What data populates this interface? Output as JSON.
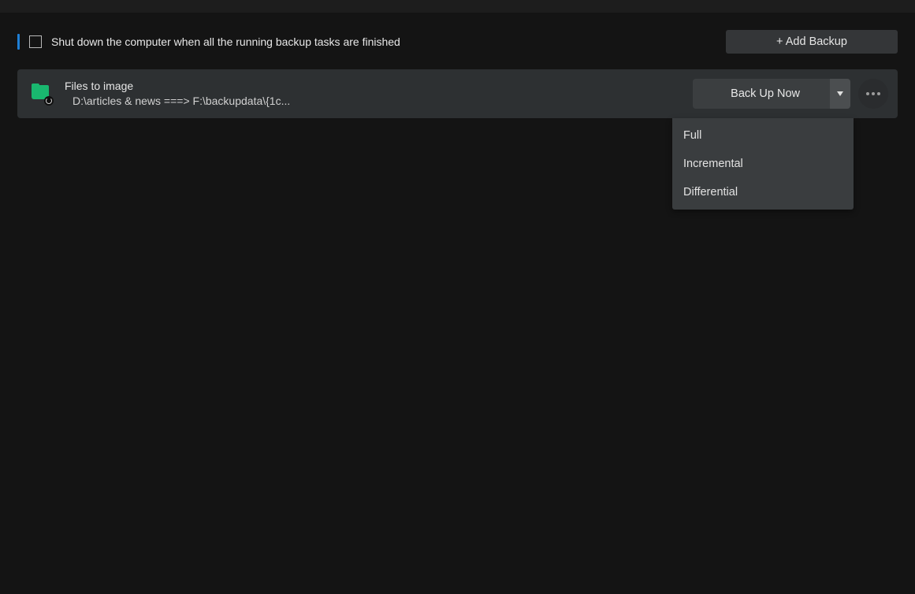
{
  "toolbar": {
    "shutdown_label": "Shut down the computer when all the running backup tasks are finished",
    "add_backup_label": "+ Add Backup"
  },
  "task": {
    "title": "Files to image",
    "subtitle": "D:\\articles & news ===> F:\\backupdata\\{1c...",
    "backup_now_label": "Back Up Now"
  },
  "menu": {
    "full": "Full",
    "incremental": "Incremental",
    "differential": "Differential"
  }
}
